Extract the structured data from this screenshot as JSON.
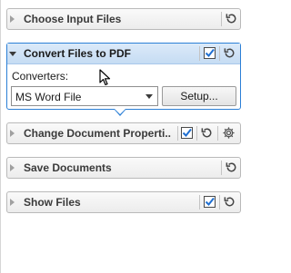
{
  "panels": {
    "choose_input": {
      "title": "Choose Input Files",
      "reset_icon": "reset-icon"
    },
    "convert": {
      "title": "Convert Files to PDF",
      "enabled_checked": true,
      "reset_icon": "reset-icon",
      "converters_label": "Converters:",
      "converter_selected": "MS Word File",
      "setup_label": "Setup..."
    },
    "change_props": {
      "title": "Change Document Properti..",
      "enabled_checked": true,
      "reset_icon": "reset-icon",
      "settings_icon": "gear-icon"
    },
    "save_docs": {
      "title": "Save Documents",
      "reset_icon": "reset-icon"
    },
    "show_files": {
      "title": "Show Files",
      "enabled_checked": true,
      "reset_icon": "reset-icon"
    }
  },
  "colors": {
    "accent": "#2b7fd6",
    "active_header": "#c6dcf3",
    "check": "#1f6fd1"
  }
}
